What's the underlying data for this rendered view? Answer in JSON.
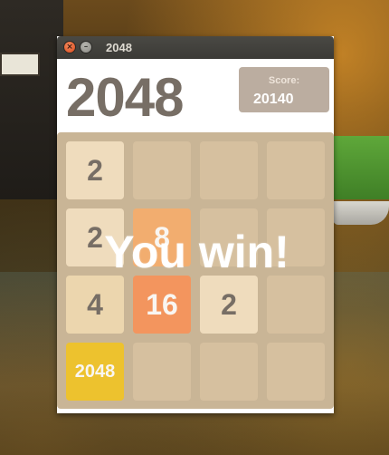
{
  "window": {
    "title": "2048",
    "close_glyph": "×",
    "minimize_glyph": "–"
  },
  "header": {
    "game_title": "2048",
    "score_label": "Score:",
    "score_value": "20140"
  },
  "board": {
    "rows": [
      [
        "2",
        "",
        "",
        ""
      ],
      [
        "2",
        "8",
        "",
        ""
      ],
      [
        "4",
        "16",
        "2",
        ""
      ],
      [
        "2048",
        "",
        "",
        ""
      ]
    ]
  },
  "overlay": {
    "message": "You win!"
  },
  "colors": {
    "board": "#c9b596",
    "empty_cell": "#d6c09f",
    "tile_2": "#efdcbd",
    "tile_4": "#ecd6ae",
    "tile_8": "#f2ad6f",
    "tile_16": "#f3955e",
    "tile_2048": "#edc22e",
    "score_box": "#bbada0",
    "title_text": "#776e65"
  }
}
